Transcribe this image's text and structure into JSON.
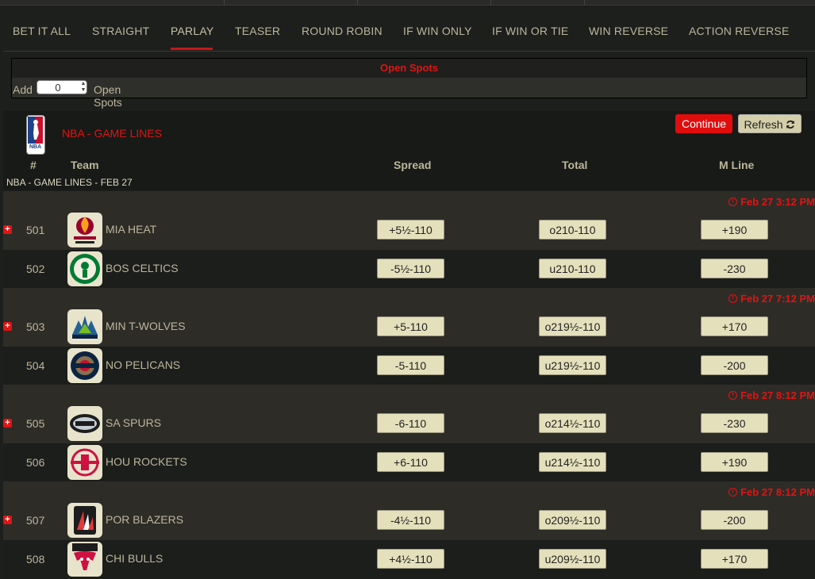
{
  "tabs": [
    {
      "label": "BET IT ALL"
    },
    {
      "label": "STRAIGHT"
    },
    {
      "label": "PARLAY"
    },
    {
      "label": "TEASER"
    },
    {
      "label": "ROUND ROBIN"
    },
    {
      "label": "IF WIN ONLY"
    },
    {
      "label": "IF WIN OR TIE"
    },
    {
      "label": "WIN REVERSE"
    },
    {
      "label": "ACTION REVERSE"
    }
  ],
  "active_tab": "PARLAY",
  "open_spots": {
    "title": "Open Spots",
    "add_label": "Add",
    "value": "0",
    "suffix_label": "Open Spots"
  },
  "section": {
    "title": "NBA - GAME LINES",
    "logo_text": "NBA",
    "continue_label": "Continue",
    "refresh_label": "Refresh",
    "refresh_icon": "refresh-icon",
    "columns": {
      "rot": "#",
      "team": "Team",
      "spread": "Spread",
      "total": "Total",
      "mline": "M Line"
    },
    "subheading": "NBA - GAME LINES - FEB 27"
  },
  "colors": {
    "accent_red": "#e01414",
    "odds_button_bg": "#e5e0bc",
    "row_light": "#2e2c27",
    "row_dark": "#1c1e1b"
  },
  "games": [
    {
      "time": "Feb 27 3:12 PM",
      "teams": [
        {
          "rot": "501",
          "name": "MIA HEAT",
          "spread": "+5½-110",
          "total": "o210-110",
          "ml": "+190",
          "logo": "heat-logo"
        },
        {
          "rot": "502",
          "name": "BOS CELTICS",
          "spread": "-5½-110",
          "total": "u210-110",
          "ml": "-230",
          "logo": "celtics-logo"
        }
      ]
    },
    {
      "time": "Feb 27 7:12 PM",
      "teams": [
        {
          "rot": "503",
          "name": "MIN T-WOLVES",
          "spread": "+5-110",
          "total": "o219½-110",
          "ml": "+170",
          "logo": "timberwolves-logo"
        },
        {
          "rot": "504",
          "name": "NO PELICANS",
          "spread": "-5-110",
          "total": "u219½-110",
          "ml": "-200",
          "logo": "pelicans-logo"
        }
      ]
    },
    {
      "time": "Feb 27 8:12 PM",
      "teams": [
        {
          "rot": "505",
          "name": "SA SPURS",
          "spread": "-6-110",
          "total": "o214½-110",
          "ml": "-230",
          "logo": "spurs-logo"
        },
        {
          "rot": "506",
          "name": "HOU ROCKETS",
          "spread": "+6-110",
          "total": "u214½-110",
          "ml": "+190",
          "logo": "rockets-logo"
        }
      ]
    },
    {
      "time": "Feb 27 8:12 PM",
      "teams": [
        {
          "rot": "507",
          "name": "POR BLAZERS",
          "spread": "-4½-110",
          "total": "o209½-110",
          "ml": "-200",
          "logo": "blazers-logo"
        },
        {
          "rot": "508",
          "name": "CHI BULLS",
          "spread": "+4½-110",
          "total": "u209½-110",
          "ml": "+170",
          "logo": "bulls-logo"
        }
      ]
    }
  ]
}
